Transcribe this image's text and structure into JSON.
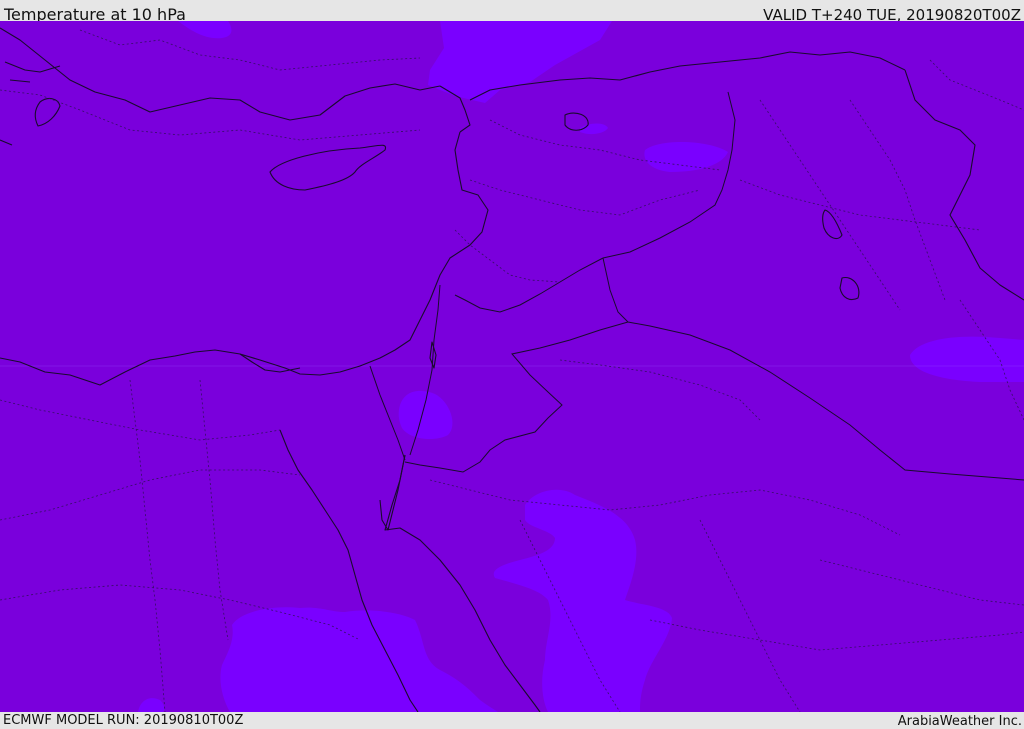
{
  "header": {
    "title": "Temperature at 10 hPa",
    "valid": "VALID T+240 TUE, 20190820T00Z"
  },
  "footer": {
    "model_run": "ECMWF MODEL RUN: 20190810T00Z",
    "publisher": "ArabiaWeather Inc."
  },
  "map": {
    "colors": {
      "base_fill": "#7a00dc",
      "warm_patch_fill": "#7a00ff",
      "boundary_line": "#1a0a2e",
      "page_background": "#e6e6e6"
    }
  }
}
